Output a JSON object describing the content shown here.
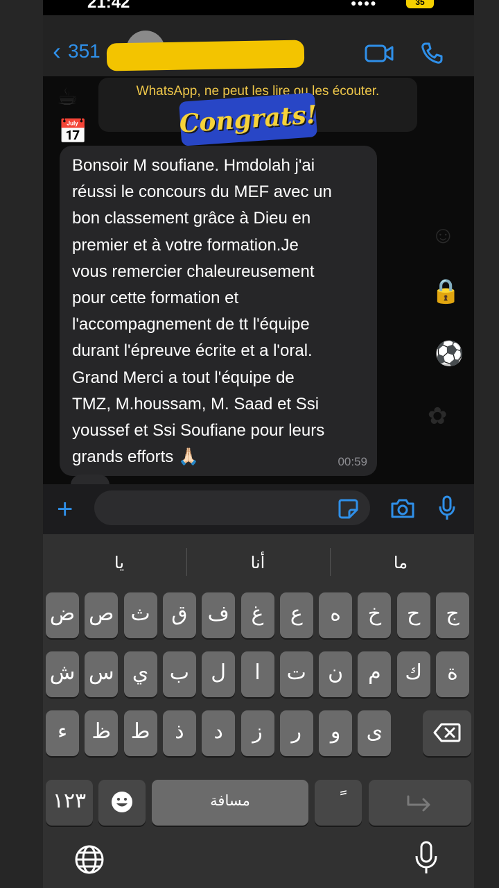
{
  "status": {
    "time": "21:42",
    "battery": "35"
  },
  "header": {
    "contact": "351",
    "back_label": "351"
  },
  "chat": {
    "notice": "WhatsApp, ne peut les lire ou les écouter.",
    "sticker": "Congrats!",
    "message": {
      "text": "Bonsoir M soufiane. Hmdolah j'ai\nréussi le concours du MEF avec un\nbon classement grâce à Dieu en\npremier et à votre formation.Je\nvous remercier chaleureusement\npour cette formation et\nl'accompagnement de tt l'équipe\ndurant l'épreuve écrite et a l'oral.\nGrand Merci a tout l'équipe de\nTMZ, M.houssam, M. Saad et Ssi\nyoussef et Ssi Soufiane pour leurs\ngrands efforts 🙏🏻",
      "time": "00:59"
    }
  },
  "input": {
    "placeholder": ""
  },
  "keyboard": {
    "suggestions": [
      "يا",
      "أنا",
      "ما"
    ],
    "row1": [
      "ض",
      "ص",
      "ث",
      "ق",
      "ف",
      "غ",
      "ع",
      "ه",
      "خ",
      "ح",
      "ج"
    ],
    "row2": [
      "ش",
      "س",
      "ي",
      "ب",
      "ل",
      "ا",
      "ت",
      "ن",
      "م",
      "ك",
      "ة"
    ],
    "row3": [
      "ء",
      "ظ",
      "ط",
      "ذ",
      "د",
      "ز",
      "ر",
      "و",
      "ى"
    ],
    "numbers_key": "١٢٣",
    "space_key": "مسافة",
    "diacritic_key": "ً"
  },
  "colors": {
    "accent": "#2f8fe8",
    "bubble": "#262628",
    "notice_text": "#f0c84a",
    "sticker_bg": "#2846c6",
    "sticker_text": "#f6d23a"
  }
}
